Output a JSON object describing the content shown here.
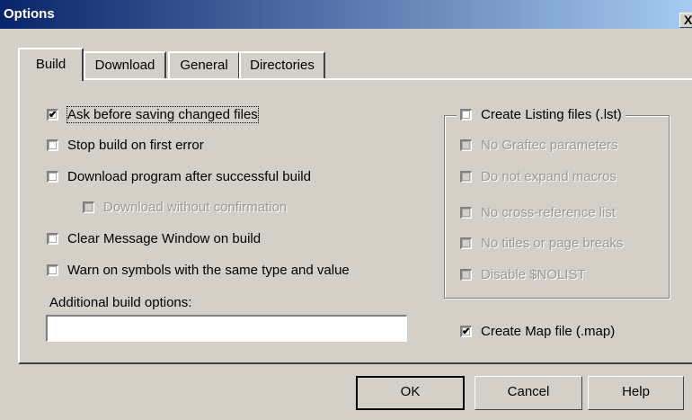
{
  "window": {
    "title": "Options",
    "close_label": "X"
  },
  "tabs": [
    "Build",
    "Download",
    "General",
    "Directories"
  ],
  "build": {
    "ask_before_saving": {
      "label": "Ask before saving changed files",
      "checked": true
    },
    "stop_on_first_error": {
      "label": "Stop build on first error",
      "checked": false
    },
    "download_after_build": {
      "label": "Download program after successful build",
      "checked": false
    },
    "download_without_confirmation": {
      "label": "Download without confirmation",
      "checked": false,
      "disabled": true
    },
    "clear_message_window": {
      "label": "Clear Message Window on build",
      "checked": false
    },
    "warn_same_type_value": {
      "label": "Warn on symbols with the same type and value",
      "checked": false
    },
    "additional_options_label": "Additional build options:",
    "additional_options_value": ""
  },
  "listing": {
    "create_listing": {
      "label": "Create Listing files (.lst)",
      "checked": false
    },
    "options": [
      {
        "label": "No Graftec parameters",
        "checked": false,
        "disabled": true
      },
      {
        "label": "Do not expand macros",
        "checked": false,
        "disabled": true
      },
      {
        "label": "No cross-reference list",
        "checked": false,
        "disabled": true
      },
      {
        "label": "No titles or page breaks",
        "checked": false,
        "disabled": true
      },
      {
        "label": "Disable $NOLIST",
        "checked": false,
        "disabled": true
      }
    ]
  },
  "create_map": {
    "label": "Create Map file (.map)",
    "checked": true
  },
  "buttons": {
    "ok": "OK",
    "cancel": "Cancel",
    "help": "Help"
  },
  "check_mark": "✔"
}
